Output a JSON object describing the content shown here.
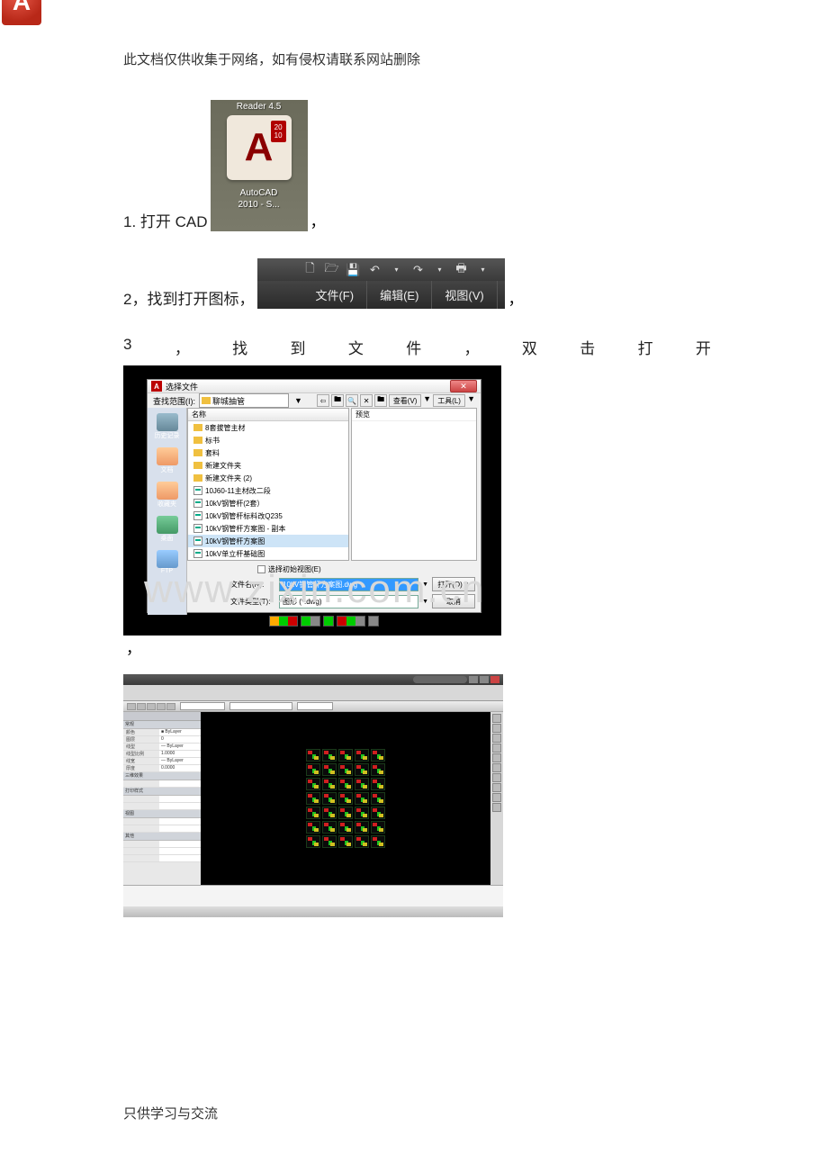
{
  "header": "此文档仅供收集于网络，如有侵权请联系网站删除",
  "footer": "只供学习与交流",
  "watermark": "www.zixin.com.cn",
  "step1": {
    "prefix": "1. 打开 CAD",
    "icon_reader": "Reader 4.5",
    "icon_badge": "20\n10",
    "icon_letter": "A",
    "icon_label_line1": "AutoCAD",
    "icon_label_line2": "2010 - S...",
    "suffix": "，"
  },
  "step2": {
    "prefix": "2，找到打开图标，",
    "menus": [
      "文件(F)",
      "编辑(E)",
      "视图(V)"
    ],
    "suffix": "，"
  },
  "step3": {
    "chars": [
      "3",
      "，",
      "找",
      "到",
      "文",
      "件",
      "，",
      "双",
      "击",
      "打",
      "开"
    ]
  },
  "dialog": {
    "title": "选择文件",
    "look_label": "查找范围(I):",
    "look_value": "聊城抽管",
    "view_btn": "查看(V)",
    "tools_btn": "工具(L)",
    "name_header": "名称",
    "preview_header": "预览",
    "sidebar": [
      "历史记录",
      "文档",
      "收藏夹",
      "桌面",
      "FTP"
    ],
    "files": [
      {
        "type": "folder",
        "name": "8套拔管主材"
      },
      {
        "type": "folder",
        "name": "标书"
      },
      {
        "type": "folder",
        "name": "套料"
      },
      {
        "type": "folder",
        "name": "新建文件夹"
      },
      {
        "type": "folder",
        "name": "新建文件夹 (2)"
      },
      {
        "type": "dwg",
        "name": "10J60-11主材改二段"
      },
      {
        "type": "dwg",
        "name": "10kV钢管杆(2套）"
      },
      {
        "type": "dwg",
        "name": "10kV钢管杆标料改Q235"
      },
      {
        "type": "dwg",
        "name": "10kV钢管杆方案图 - 副本"
      },
      {
        "type": "dwg",
        "name": "10kV钢管杆方案图",
        "selected": true
      },
      {
        "type": "dwg",
        "name": "10kV单立杆基础图"
      }
    ],
    "initial_view_check": "选择初始视图(E)",
    "filename_label": "文件名(N):",
    "filename_value": "10kV钢管杆方案图.dwg",
    "filetype_label": "文件类型(T):",
    "filetype_value": "图形 (*.dwg)",
    "open_btn": "打开(O)",
    "cancel_btn": "取消"
  },
  "cad": {
    "prop_groups": [
      "常规",
      "三维效果",
      "打印样式",
      "视图",
      "其他"
    ],
    "prop_rows": [
      {
        "k": "颜色",
        "v": "■ ByLayer"
      },
      {
        "k": "图层",
        "v": "0"
      },
      {
        "k": "线型",
        "v": "— ByLayer"
      },
      {
        "k": "线型比例",
        "v": "1.0000"
      },
      {
        "k": "线宽",
        "v": "— ByLayer"
      },
      {
        "k": "厚度",
        "v": "0.0000"
      }
    ]
  }
}
